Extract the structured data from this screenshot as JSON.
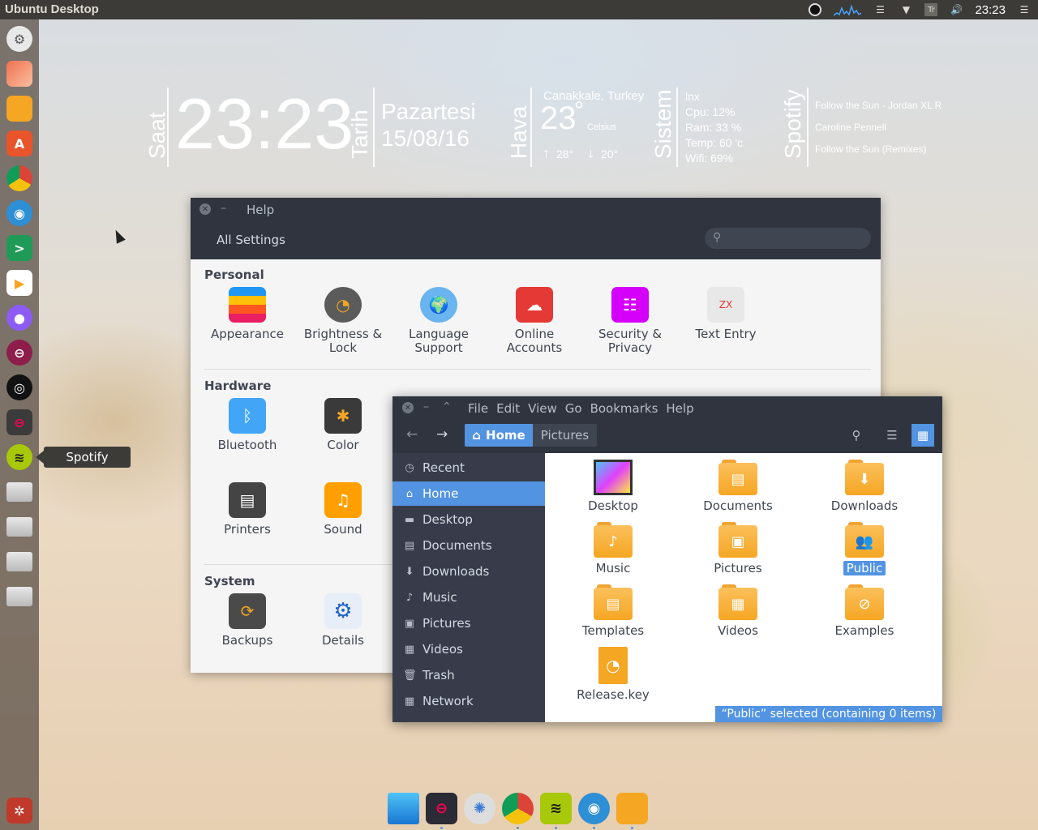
{
  "top_panel": {
    "title": "Ubuntu Desktop",
    "clock": "23:23",
    "keyboard": "Tr"
  },
  "launcher": {
    "tooltip": "Spotify"
  },
  "conky": {
    "time_label": "Saat",
    "time": "23:23",
    "date_label": "Tarih",
    "day": "Pazartesi",
    "date": "15/08/16",
    "weather_label": "Hava",
    "location": "Canakkale, Turkey",
    "temp": "23",
    "degree": "°",
    "unit": "Celsius",
    "high": "28°",
    "low": "20°",
    "system_label": "Sistem",
    "os": "lnx",
    "cpu": "Cpu: 12%",
    "ram": "Ram: 33 %",
    "temp_sys": "Temp: 60 'c",
    "wifi": "Wifi: 69%",
    "spotify_label": "Spotify",
    "track": "Follow the Sun - Jordan XL R",
    "artist": "Caroline Pennell",
    "album": "Follow the Sun (Remixes)"
  },
  "settings": {
    "window_title": "Help",
    "header": "All Settings",
    "sections": {
      "personal": "Personal",
      "hardware": "Hardware",
      "system": "System"
    },
    "personal": [
      {
        "l1": "Appearance",
        "l2": ""
      },
      {
        "l1": "Brightness &",
        "l2": "Lock"
      },
      {
        "l1": "Language",
        "l2": "Support"
      },
      {
        "l1": "Online",
        "l2": "Accounts"
      },
      {
        "l1": "Security &",
        "l2": "Privacy"
      },
      {
        "l1": "Text Entry",
        "l2": ""
      }
    ],
    "hardware": [
      "Bluetooth",
      "Color",
      "Printers",
      "Sound"
    ],
    "system": [
      "Backups",
      "Details"
    ]
  },
  "files": {
    "menu": [
      "File",
      "Edit",
      "View",
      "Go",
      "Bookmarks",
      "Help"
    ],
    "crumbs": [
      "Home",
      "Pictures"
    ],
    "sidebar": [
      "Recent",
      "Home",
      "Desktop",
      "Documents",
      "Downloads",
      "Music",
      "Pictures",
      "Videos",
      "Trash",
      "Network"
    ],
    "items": [
      "Desktop",
      "Documents",
      "Downloads",
      "Music",
      "Pictures",
      "Public",
      "Templates",
      "Videos",
      "Examples",
      "Release.key"
    ],
    "status": "“Public” selected  (containing 0 items)"
  },
  "colors": {
    "accent": "#5294e2",
    "panel": "#2f343f",
    "sidebar": "#383c4a",
    "folder": "#f5a623"
  }
}
